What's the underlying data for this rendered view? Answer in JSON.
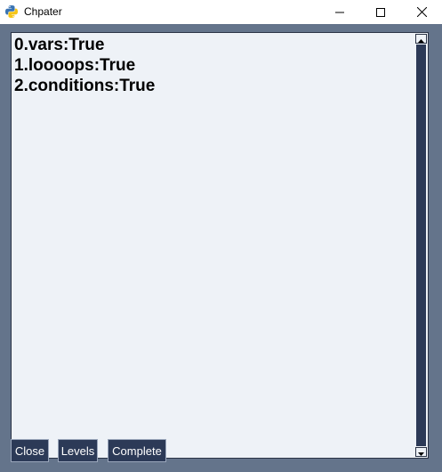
{
  "window": {
    "title": "Chpater",
    "app_icon": "python-icon",
    "controls": {
      "minimize_icon": "minimize-icon",
      "maximize_icon": "maximize-icon",
      "close_icon": "close-icon"
    }
  },
  "textarea": {
    "lines": [
      "0.vars:True",
      "1.loooops:True",
      "2.conditions:True"
    ]
  },
  "buttons": {
    "close": "Close",
    "levels": "Levels",
    "complete": "Complete"
  },
  "colors": {
    "window_bg": "#64748b",
    "text_bg": "#eef2f7",
    "button_bg": "#2c3a57",
    "button_text": "#ffffff"
  }
}
